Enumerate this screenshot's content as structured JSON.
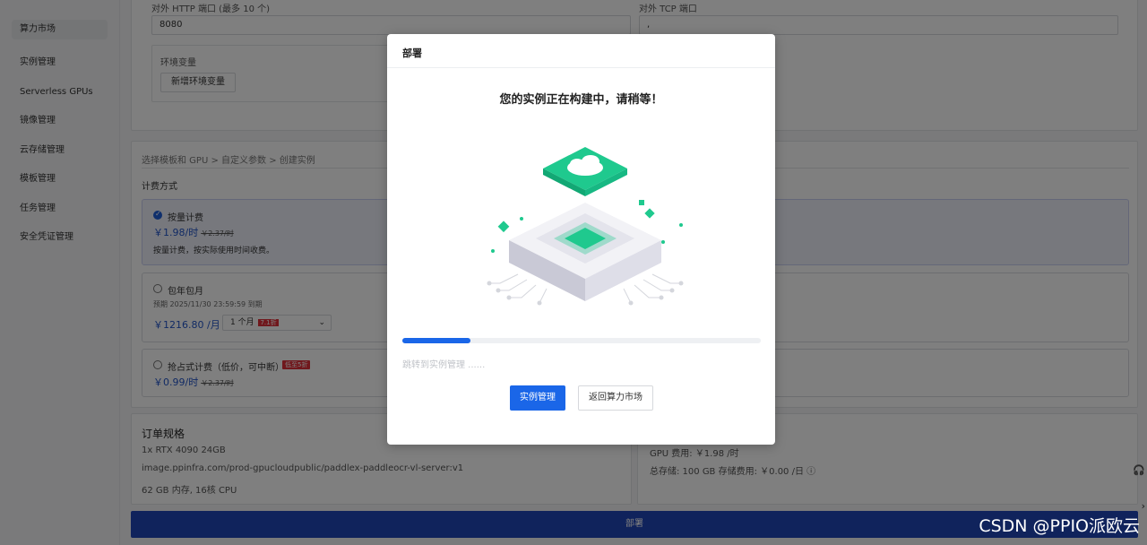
{
  "sidebar": {
    "items": [
      {
        "label": "算力市场",
        "active": true
      },
      {
        "label": "实例管理"
      },
      {
        "label": "Serverless GPUs"
      },
      {
        "label": "镜像管理"
      },
      {
        "label": "云存储管理"
      },
      {
        "label": "模板管理"
      },
      {
        "label": "任务管理"
      },
      {
        "label": "安全凭证管理"
      }
    ]
  },
  "config": {
    "http_port_label": "对外 HTTP 端口 (最多 10 个)",
    "http_port_value": "8080",
    "tcp_port_label": "对外 TCP 端口",
    "tcp_port_value": ",",
    "env_label": "环境变量",
    "add_env_button": "新增环境变量"
  },
  "billing": {
    "breadcrumb": "选择模板和 GPU > 自定义参数 > 创建实例",
    "section_label": "计费方式",
    "options": [
      {
        "title": "按量计费",
        "price": "￥1.98/时",
        "original": "￥2.37/时",
        "desc": "按量计费，按实际使用时间收费。",
        "selected": true
      },
      {
        "title": "包年包月",
        "expire": "预期 2025/11/30 23:59:59 到期",
        "price": "￥1216.80 /月",
        "select_value": "1 个月",
        "select_badge": "7.1折"
      },
      {
        "title": "抢占式计费（低价，可中断）",
        "badge": "低至5折",
        "price": "￥0.99/时",
        "original": "￥2.37/时"
      }
    ]
  },
  "order": {
    "title": "订单规格",
    "lines": [
      "1x RTX 4090 24GB",
      "image.ppinfra.com/prod-gpucloudpublic/paddlex-paddleocr-vl-server:v1",
      "62 GB 内存, 16核 CPU"
    ],
    "gpu_fee": "GPU 费用: ￥1.98 /时",
    "storage_fee": "总存储: 100 GB 存储费用: ￥0.00 /日"
  },
  "deploy_button": "部署",
  "modal": {
    "title": "部署",
    "message": "您的实例正在构建中，请稍等！",
    "progress": 0.19,
    "jump_text": "跳转到实例管理 ......",
    "primary_button": "实例管理",
    "secondary_button": "返回算力市场",
    "accent_color": "#1a66e8",
    "chip_color": "#1fc98e"
  },
  "watermark": "CSDN @PPIO派欧云"
}
